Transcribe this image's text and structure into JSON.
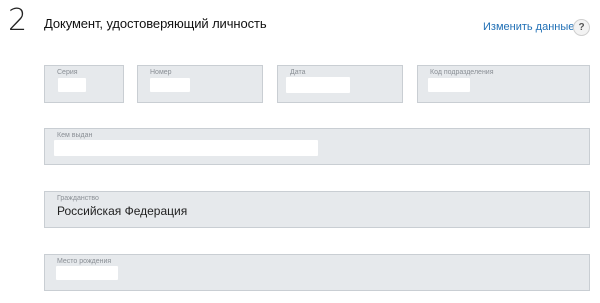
{
  "section": {
    "step": "2",
    "title": "Документ, удостоверяющий личность",
    "edit_link": "Изменить данные",
    "help": "?"
  },
  "fields": {
    "series": {
      "label": "Серия",
      "value": ""
    },
    "number": {
      "label": "Номер",
      "value": ""
    },
    "date": {
      "label": "Дата",
      "value": ""
    },
    "dept_code": {
      "label": "Код подразделения",
      "value": ""
    },
    "issued_by": {
      "label": "Кем выдан",
      "value": ""
    },
    "citizenship": {
      "label": "Гражданство",
      "value": "Российская Федерация"
    },
    "birthplace": {
      "label": "Место рождения",
      "value": ""
    }
  },
  "colors": {
    "field_bg": "#e6e9ec",
    "field_border": "#c9ced3",
    "link": "#1f6fb5"
  }
}
